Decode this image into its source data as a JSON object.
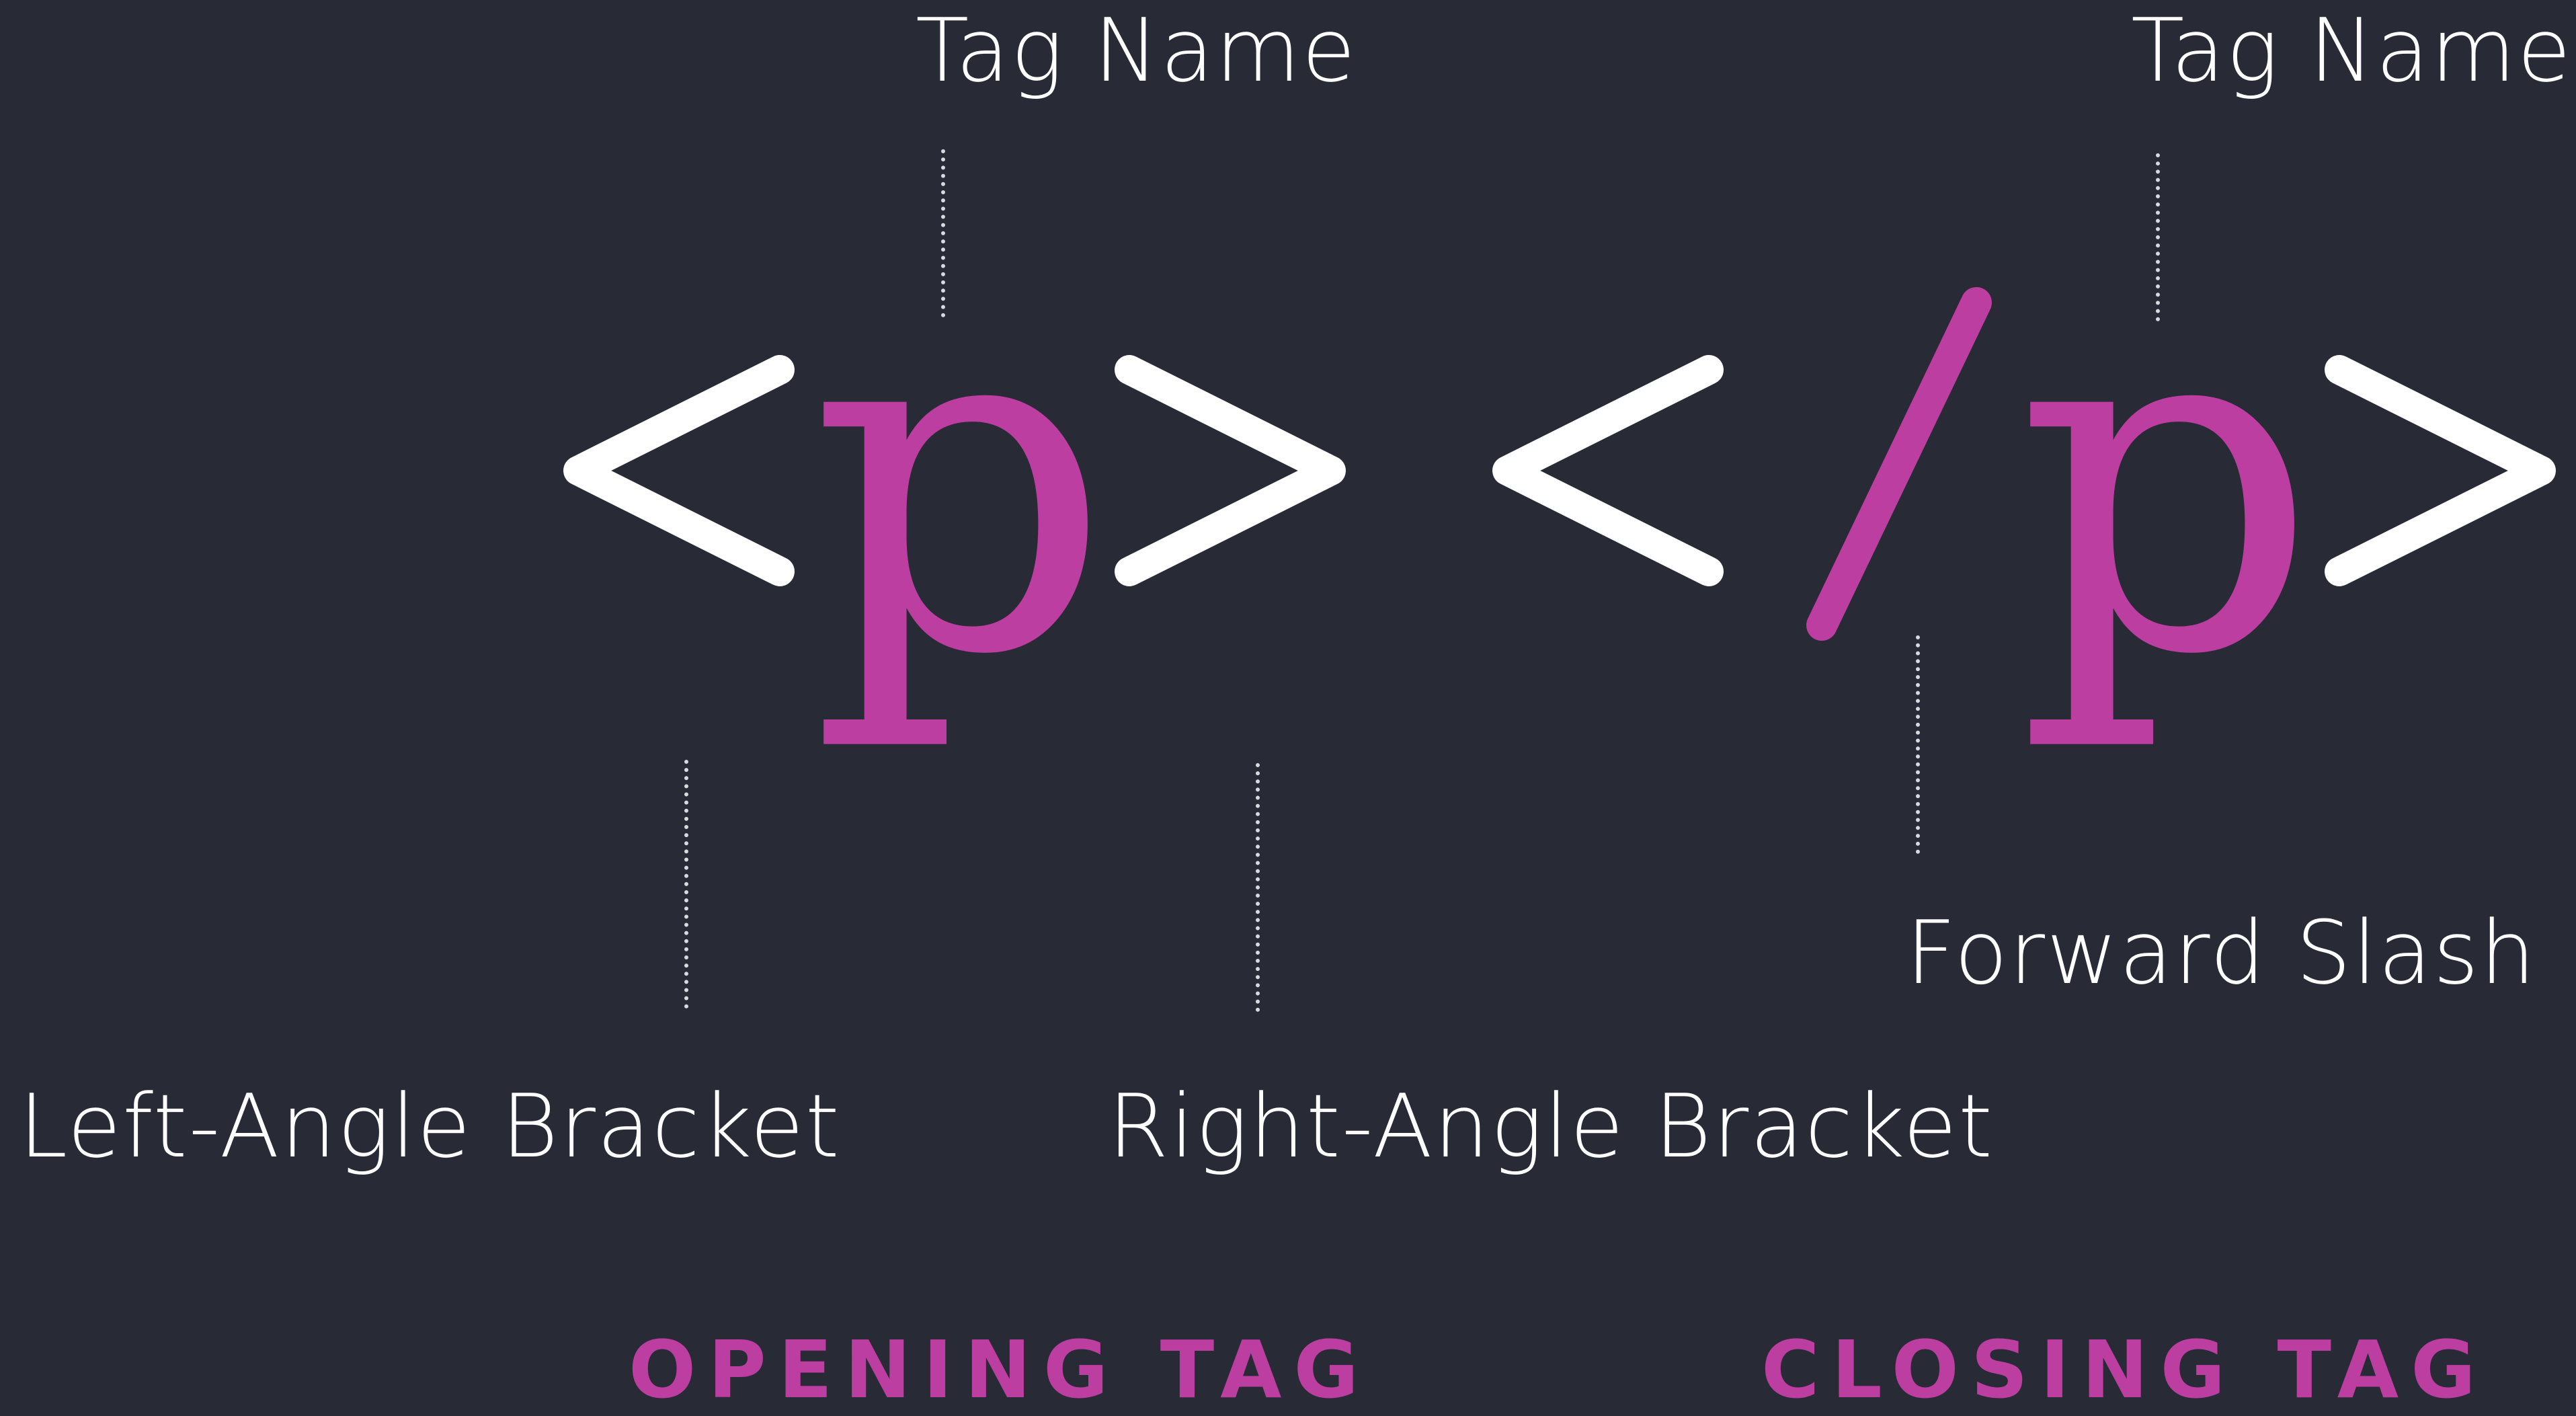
{
  "colors": {
    "background": "#282a36",
    "bracket": "#ffffff",
    "accent": "#bb3ea0",
    "leader": "#d9dae0"
  },
  "glyphs": {
    "open_left_bracket": "<",
    "open_tag_name": "p",
    "open_right_bracket": ">",
    "close_left_bracket": "<",
    "close_slash": "/",
    "close_tag_name": "p",
    "close_right_bracket": ">"
  },
  "labels": {
    "tag_name_open": "Tag Name",
    "tag_name_close": "Tag Name",
    "left_angle_bracket": "Left-Angle Bracket",
    "right_angle_bracket": "Right-Angle Bracket",
    "forward_slash": "Forward Slash"
  },
  "sections": {
    "opening": "OPENING TAG",
    "closing": "CLOSING TAG"
  }
}
